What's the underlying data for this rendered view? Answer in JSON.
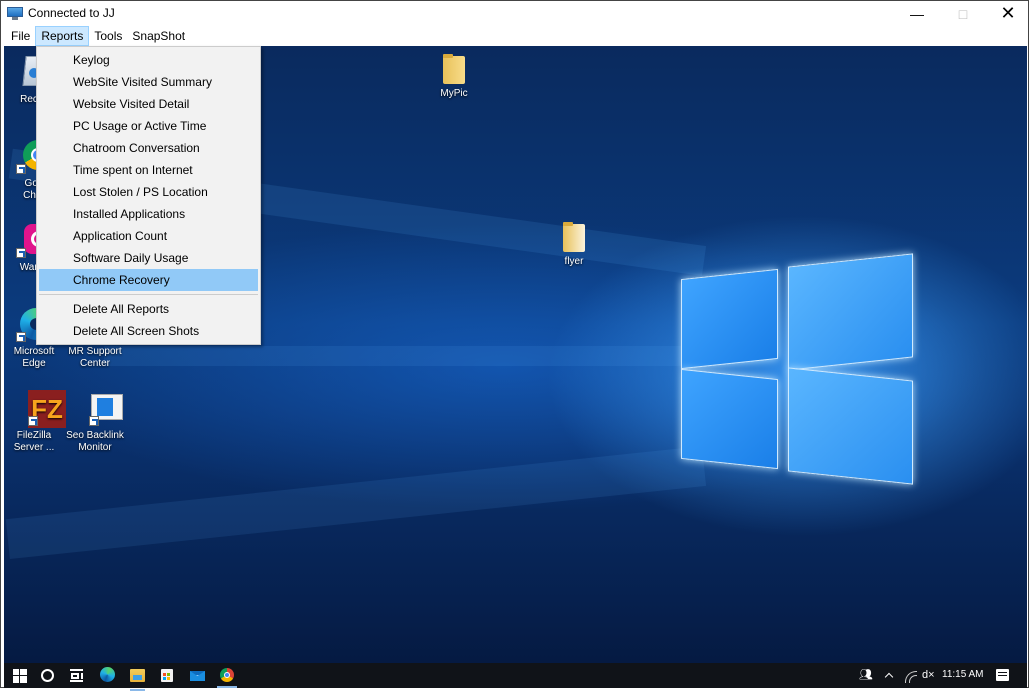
{
  "window": {
    "title": "Connected to JJ",
    "controls": {
      "minimize": "—",
      "maximize": "□",
      "close": "✕"
    }
  },
  "menubar": {
    "items": [
      {
        "label": "File"
      },
      {
        "label": "Reports",
        "open": true
      },
      {
        "label": "Tools"
      },
      {
        "label": "SnapShot"
      }
    ]
  },
  "reports_menu": {
    "items": [
      "Keylog",
      "WebSite Visited Summary",
      "Website Visited Detail",
      "PC Usage or Active Time",
      "Chatroom Conversation",
      "Time spent on Internet",
      "Lost Stolen / PS Location",
      "Installed Applications",
      "Application Count",
      "Software Daily Usage",
      "Chrome Recovery"
    ],
    "highlighted": "Chrome Recovery",
    "danger_items": [
      "Delete All Reports",
      "Delete All Screen Shots"
    ]
  },
  "desktop": {
    "icons": [
      {
        "label": "Recycle Bin",
        "visible_label": "Recyc",
        "icon": "recycle-bin-icon"
      },
      {
        "label": "Google Chrome",
        "visible_label_1": "Goo",
        "visible_label_2": "Chro",
        "icon": "chrome-icon"
      },
      {
        "label": "Wamp",
        "visible_label": "Wamp",
        "icon": "wamp-icon"
      },
      {
        "label_1": "Microsoft",
        "label_2": "Edge",
        "icon": "edge-icon"
      },
      {
        "label_1": "MR Support",
        "label_2": "Center",
        "icon": "support-icon"
      },
      {
        "label_1": "FileZilla",
        "label_2": "Server ...",
        "icon": "filezilla-icon"
      },
      {
        "label_1": "Seo Backlink",
        "label_2": "Monitor",
        "icon": "monitor-app-icon"
      },
      {
        "label": "MyPic",
        "icon": "folder-icon"
      },
      {
        "label": "flyer",
        "icon": "folder-icon"
      }
    ]
  },
  "taskbar": {
    "pinned": [
      "start-icon",
      "cortana-icon",
      "task-view-icon",
      "edge-icon",
      "file-explorer-icon",
      "store-icon",
      "mail-icon",
      "chrome-icon"
    ],
    "tray": {
      "time": "11:15 AM"
    }
  }
}
